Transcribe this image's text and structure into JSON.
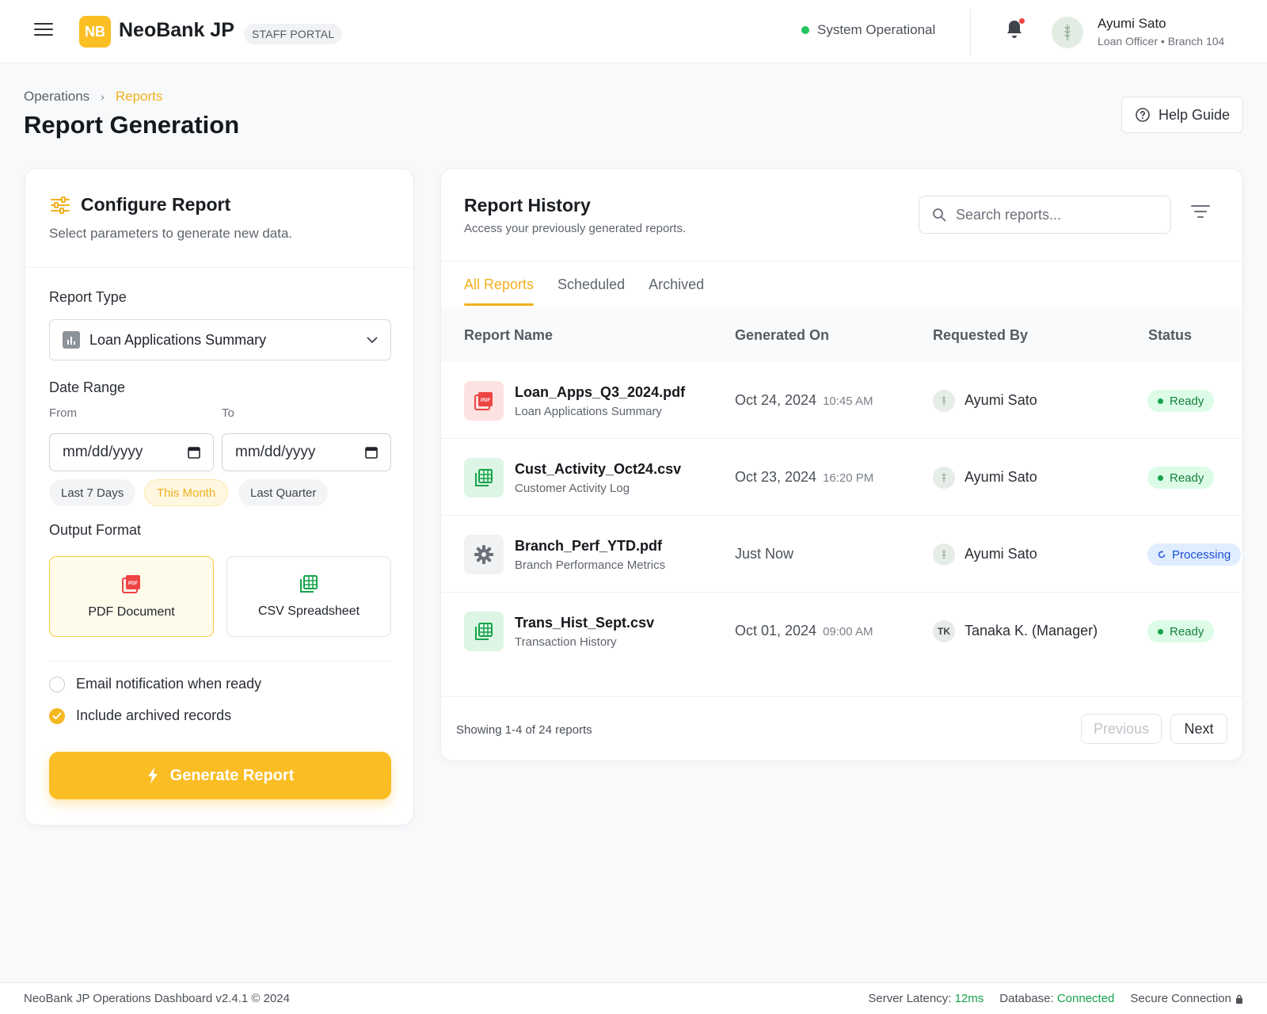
{
  "header": {
    "logo_badge": "NB",
    "brand": "NeoBank JP",
    "portal_label": "STAFF PORTAL",
    "system_status": "System Operational",
    "user": {
      "name": "Ayumi Sato",
      "role": "Loan Officer • Branch 104"
    }
  },
  "page": {
    "breadcrumb": [
      "Operations",
      "Reports"
    ],
    "title": "Report Generation",
    "help_button": "Help Guide"
  },
  "configure": {
    "title": "Configure Report",
    "subtitle": "Select parameters to generate new data.",
    "report_type_label": "Report Type",
    "report_type_value": "Loan Applications Summary",
    "date_range_label": "Date Range",
    "from_label": "From",
    "to_label": "To",
    "from_value": "mm/dd/yyyy",
    "to_value": "mm/dd/yyyy",
    "presets": [
      "Last 7 Days",
      "This Month",
      "Last Quarter"
    ],
    "selected_preset": "This Month",
    "output_format_label": "Output Format",
    "formats": [
      "PDF Document",
      "CSV Spreadsheet"
    ],
    "selected_format": "PDF Document",
    "options": [
      {
        "label": "Email notification when ready",
        "checked": false
      },
      {
        "label": "Include archived records",
        "checked": true
      }
    ],
    "generate_button": "Generate Report"
  },
  "history": {
    "title": "Report History",
    "subtitle": "Access your previously generated reports.",
    "search_placeholder": "Search reports...",
    "tabs": [
      "All Reports",
      "Scheduled",
      "Archived"
    ],
    "active_tab": "All Reports",
    "columns": [
      "Report Name",
      "Generated On",
      "Requested By",
      "Status"
    ],
    "rows": [
      {
        "file": "Loan_Apps_Q3_2024.pdf",
        "desc": "Loan Applications Summary",
        "date": "Oct 24, 2024",
        "time": "10:45 AM",
        "requested_by": "Ayumi Sato",
        "avatar": "",
        "status": "Ready",
        "icon": "pdf-icon"
      },
      {
        "file": "Cust_Activity_Oct24.csv",
        "desc": "Customer Activity Log",
        "date": "Oct 23, 2024",
        "time": "16:20 PM",
        "requested_by": "Ayumi Sato",
        "avatar": "",
        "status": "Ready",
        "icon": "spreadsheet-icon"
      },
      {
        "file": "Branch_Perf_YTD.pdf",
        "desc": "Branch Performance Metrics",
        "date": "Just Now",
        "time": "",
        "requested_by": "Ayumi Sato",
        "avatar": "",
        "status": "Processing",
        "icon": "gear-icon"
      },
      {
        "file": "Trans_Hist_Sept.csv",
        "desc": "Transaction History",
        "date": "Oct 01, 2024",
        "time": "09:00 AM",
        "requested_by": "Tanaka K. (Manager)",
        "avatar": "TK",
        "status": "Ready",
        "icon": "spreadsheet-icon"
      }
    ],
    "showing": "Showing 1-4 of 24 reports",
    "prev_button": "Previous",
    "next_button": "Next"
  },
  "footer": {
    "left": "NeoBank JP Operations Dashboard v2.4.1 © 2024",
    "latency_label": "Server Latency:",
    "latency_value": "12ms",
    "db_label": "Database:",
    "db_value": "Connected",
    "secure": "Secure Connection"
  },
  "colors": {
    "accent": "#fbbd24",
    "ready": "#16a34a",
    "processing": "#1d4ed8",
    "alert": "#ef4444"
  }
}
